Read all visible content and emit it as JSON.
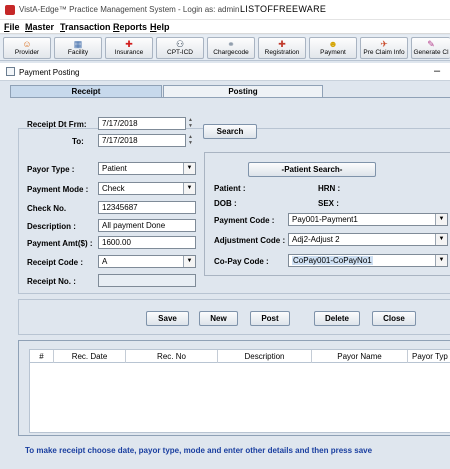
{
  "app": {
    "title": "VistA-Edge™ Practice Management System - Login as: admin",
    "watermark": "LISTOFFREEWARE"
  },
  "menu": [
    "File",
    "Master",
    "Transaction",
    "Reports",
    "Help"
  ],
  "toolbar": [
    {
      "label": "Provider",
      "icon": "provider-icon",
      "glyph": "☺",
      "color": "#d86a16"
    },
    {
      "label": "Facility",
      "icon": "facility-icon",
      "glyph": "▦",
      "color": "#3a68a8"
    },
    {
      "label": "Insurance",
      "icon": "insurance-icon",
      "glyph": "✚",
      "color": "#d11d1d"
    },
    {
      "label": "CPT-ICD",
      "icon": "cpt-icd-icon",
      "glyph": "⚇",
      "color": "#2c3e50"
    },
    {
      "label": "Chargecode",
      "icon": "chargecode-icon",
      "glyph": "⚭",
      "color": "#6b7d90"
    },
    {
      "label": "Registration",
      "icon": "registration-icon",
      "glyph": "✚",
      "color": "#c0392b"
    },
    {
      "label": "Payment",
      "icon": "payment-icon",
      "glyph": "☻",
      "color": "#d4a300"
    },
    {
      "label": "Pre Claim Info",
      "icon": "pre-claim-info-icon",
      "glyph": "✈",
      "color": "#c94a2a"
    },
    {
      "label": "Generate Cl",
      "icon": "generate-claim-icon",
      "glyph": "✎",
      "color": "#b23a8a"
    }
  ],
  "window": {
    "title": "Payment Posting",
    "minimize": "–"
  },
  "tabs": [
    "Receipt",
    "Posting"
  ],
  "filter": {
    "from_label": "Receipt Dt Frm:",
    "from_value": "7/17/2018",
    "to_label": "To:",
    "to_value": "7/17/2018",
    "search_button": "Search"
  },
  "form": {
    "payor_type_label": "Payor Type :",
    "payor_type_value": "Patient",
    "payment_mode_label": "Payment Mode :",
    "payment_mode_value": "Check",
    "check_no_label": "Check No.",
    "check_no_value": "12345687",
    "description_label": "Description :",
    "description_value": "All payment Done",
    "payment_amt_label": "Payment Amt($) :",
    "payment_amt_value": "1600.00",
    "receipt_code_label": "Receipt Code :",
    "receipt_code_value": "A",
    "receipt_no_label": "Receipt No. :",
    "receipt_no_value": ""
  },
  "patient": {
    "search_button": "-Patient Search-",
    "patient_label": "Patient :",
    "hrn_label": "HRN :",
    "dob_label": "DOB :",
    "sex_label": "SEX :",
    "payment_code_label": "Payment Code :",
    "payment_code_value": "Pay001-Payment1",
    "adjustment_code_label": "Adjustment Code :",
    "adjustment_code_value": "Adj2-Adjust 2",
    "copay_code_label": "Co-Pay Code :",
    "copay_code_value": "CoPay001-CoPayNo1"
  },
  "actions": [
    "Save",
    "New",
    "Post",
    "Delete",
    "Close"
  ],
  "grid": {
    "columns": [
      "#",
      "Rec. Date",
      "Rec. No",
      "Description",
      "Payor Name",
      "Payor Typ"
    ]
  },
  "hint": "To make receipt choose date, payor type, mode and enter other details and then press save"
}
